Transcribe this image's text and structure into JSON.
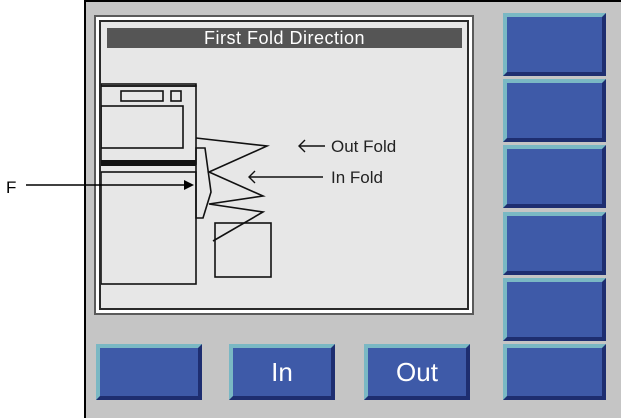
{
  "screen": {
    "title": "First Fold Direction",
    "labels": {
      "out_fold": "Out Fold",
      "in_fold": "In Fold"
    }
  },
  "buttons": {
    "bottom": [
      {
        "label": ""
      },
      {
        "label": "In"
      },
      {
        "label": "Out"
      },
      {
        "label": ""
      }
    ],
    "side": [
      {
        "label": ""
      },
      {
        "label": ""
      },
      {
        "label": ""
      },
      {
        "label": ""
      },
      {
        "label": ""
      }
    ]
  },
  "callout": {
    "label": "F"
  },
  "colors": {
    "panel": "#c5c5c5",
    "button_face": "#3e5aa8",
    "button_highlight": "#7ab8c4",
    "button_shadow": "#1e2e70",
    "title_bar": "#555555"
  }
}
